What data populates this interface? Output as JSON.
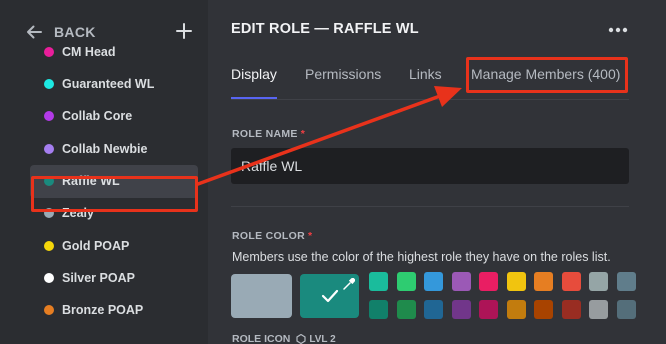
{
  "sidebar": {
    "back_label": "BACK",
    "roles": [
      {
        "name": "CM Head",
        "color": "#e91e9b"
      },
      {
        "name": "Guaranteed WL",
        "color": "#1de9e3"
      },
      {
        "name": "Collab Core",
        "color": "#b33ae8"
      },
      {
        "name": "Collab Newbie",
        "color": "#a57ef0"
      },
      {
        "name": "Raffle WL",
        "color": "#1a8a7e",
        "selected": true
      },
      {
        "name": "Zealy",
        "color": "#99aab5"
      },
      {
        "name": "Gold POAP",
        "color": "#f5d60a"
      },
      {
        "name": "Silver POAP",
        "color": "#ffffff"
      },
      {
        "name": "Bronze POAP",
        "color": "#e67e22"
      }
    ]
  },
  "header": {
    "title": "EDIT ROLE — RAFFLE WL"
  },
  "tabs": [
    {
      "label": "Display",
      "active": true
    },
    {
      "label": "Permissions"
    },
    {
      "label": "Links"
    },
    {
      "label": "Manage Members (400)"
    }
  ],
  "role_name": {
    "label": "ROLE NAME",
    "required_mark": "*",
    "value": "Raffle WL"
  },
  "role_color": {
    "label": "ROLE COLOR",
    "required_mark": "*",
    "help_text": "Members use the color of the highest role they have on the roles list.",
    "default_color": "#99aab5",
    "selected_color": "#1a8a7e",
    "palette_top": [
      "#1abc9c",
      "#2ecc71",
      "#3498db",
      "#9b59b6",
      "#e91e63",
      "#f1c40f",
      "#e67e22",
      "#e74c3c",
      "#95a5a6",
      "#607d8b"
    ],
    "palette_bottom": [
      "#11806a",
      "#1f8b4c",
      "#206694",
      "#71368a",
      "#ad1457",
      "#c27c0e",
      "#a84300",
      "#992d22",
      "#979c9f",
      "#546e7a"
    ]
  },
  "role_icon": {
    "label": "ROLE ICON",
    "badge": "LVL 2"
  },
  "annotation": {
    "color": "#e8321b"
  }
}
